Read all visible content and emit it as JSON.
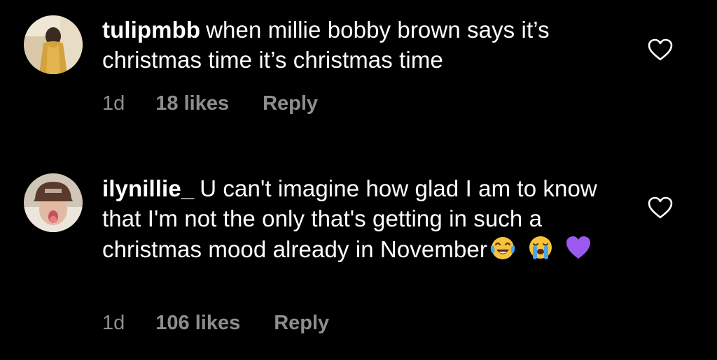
{
  "comments": [
    {
      "username": "tulipmbb",
      "text": "when millie bobby brown says it’s christmas time it’s christmas time",
      "time": "1d",
      "likes": "18 likes",
      "reply": "Reply"
    },
    {
      "username": "ilynillie_",
      "text": "U can't imagine how glad I am to know that I'm not the only that's getting in such a christmas mood already in November",
      "emojis": [
        "face-with-tears-of-joy",
        "loudly-crying-face",
        "purple-heart"
      ],
      "time": "1d",
      "likes": "106 likes",
      "reply": "Reply"
    }
  ],
  "colors": {
    "background": "#000000",
    "text": "#ffffff",
    "meta": "#8e8e8e",
    "purple_heart": "#9b59f0"
  }
}
